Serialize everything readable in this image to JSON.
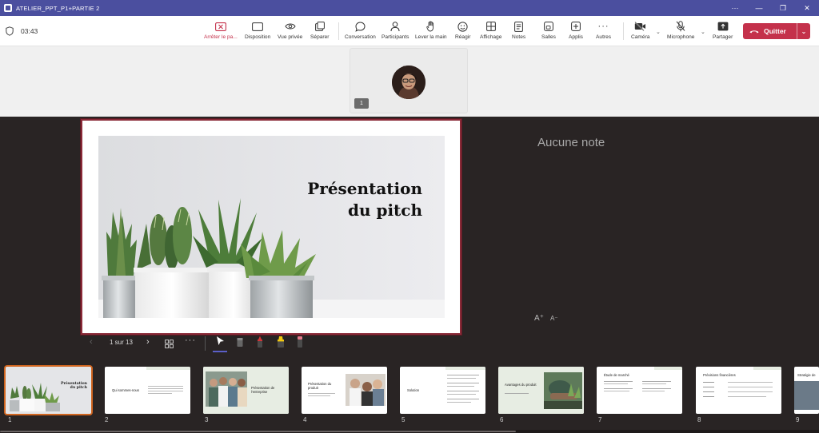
{
  "window": {
    "title": "ATELIER_PPT_P1+PARTIE 2",
    "controls": [
      "···",
      "—",
      "❐",
      "✕"
    ]
  },
  "meeting": {
    "timer": "03:43"
  },
  "toolbar": {
    "stop_presenting": "Arrêter le pa...",
    "layout": "Disposition",
    "private_view": "Vue privée",
    "separate": "Séparer",
    "chat": "Conversation",
    "participants": "Participants",
    "raise_hand": "Lever la main",
    "react": "Réagir",
    "view": "Affichage",
    "notes": "Notes",
    "rooms": "Salles",
    "apps": "Applis",
    "more": "Autres",
    "camera": "Caméra",
    "microphone": "Microphone",
    "share": "Partager",
    "quit": "Quitter"
  },
  "video_tile": {
    "badge": "1"
  },
  "presentation": {
    "slide_title": "Présentation du pitch",
    "notes": "Aucune note",
    "font_increase": "A⁺",
    "font_decrease": "A⁻",
    "page_counter": "1 sur 13",
    "current_slide": 1,
    "total_slides": 13
  },
  "thumbnails": [
    {
      "number": "1",
      "title": "Présentation du pitch"
    },
    {
      "number": "2",
      "title": "Qui sommes-nous"
    },
    {
      "number": "3",
      "title": "Présentation de l'entreprise"
    },
    {
      "number": "4",
      "title": "Présentation du produit"
    },
    {
      "number": "5",
      "title": "Solution"
    },
    {
      "number": "6",
      "title": "Avantages du produit"
    },
    {
      "number": "7",
      "title": "Étude de marché"
    },
    {
      "number": "8",
      "title": "Prévisions financières"
    },
    {
      "number": "9",
      "title": "Stratégie de"
    }
  ],
  "colors": {
    "titlebar": "#4b4f9f",
    "quit_button": "#c4314b",
    "presenter_bg": "#292424",
    "active_thumb_border": "#d0651f",
    "slide_border": "#8a2a38",
    "accent": "#5b5fc7"
  },
  "icons": {
    "stop_presenting": "stop-share-icon",
    "layout": "layout-icon",
    "private_view": "eye-icon",
    "separate": "popout-icon",
    "chat": "chat-icon",
    "participants": "person-icon",
    "raise_hand": "hand-icon",
    "react": "smiley-icon",
    "view": "grid-icon",
    "notes": "notes-icon",
    "rooms": "rooms-icon",
    "apps": "plus-icon",
    "more": "ellipsis-icon",
    "camera": "camera-off-icon",
    "microphone": "mic-off-icon",
    "share": "share-icon",
    "quit": "phone-hangup-icon"
  }
}
